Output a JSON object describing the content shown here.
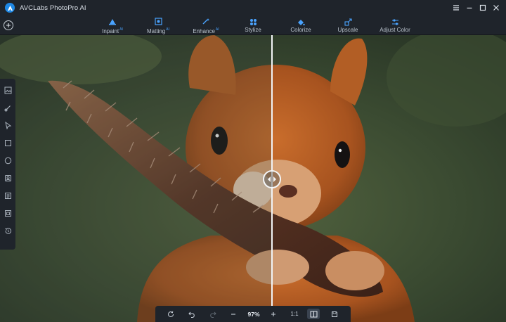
{
  "app": {
    "title": "AVCLabs PhotoPro AI"
  },
  "toolbar": {
    "tools": [
      {
        "label": "Inpaint",
        "badge": "AI",
        "icon": "inpaint-icon"
      },
      {
        "label": "Matting",
        "badge": "AI",
        "icon": "matting-icon"
      },
      {
        "label": "Enhance",
        "badge": "AI",
        "icon": "enhance-icon"
      },
      {
        "label": "Stylize",
        "badge": "",
        "icon": "stylize-icon"
      },
      {
        "label": "Colorize",
        "badge": "",
        "icon": "colorize-icon"
      },
      {
        "label": "Upscale",
        "badge": "",
        "icon": "upscale-icon"
      },
      {
        "label": "Adjust Color",
        "badge": "",
        "icon": "adjust-color-icon"
      }
    ]
  },
  "sidebar": {
    "icons": [
      "image-icon",
      "brush-icon",
      "pointer-icon",
      "rectangle-icon",
      "ellipse-icon",
      "portrait-icon",
      "text-select-icon",
      "object-select-icon",
      "history-icon"
    ]
  },
  "bottom_bar": {
    "zoom": "97%",
    "ratio_label": "1:1"
  },
  "colors": {
    "accent": "#4aa3ff",
    "chrome": "#1f242b",
    "divider": "#f2f4f6"
  }
}
